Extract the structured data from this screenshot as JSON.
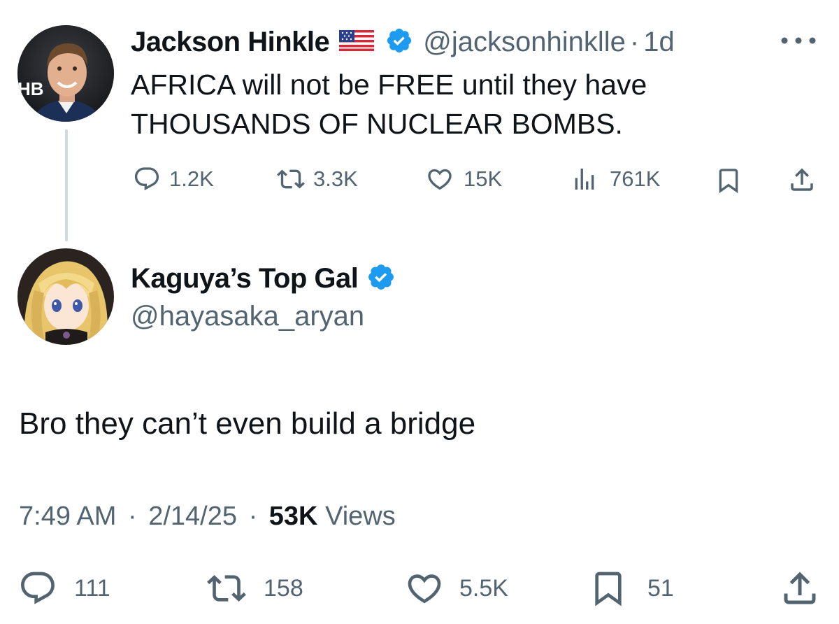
{
  "parent_tweet": {
    "author_name": "Jackson Hinkle",
    "flag_icon": "us-flag-icon",
    "verified_icon": "verified-badge-icon",
    "handle": "@jacksonhinklle",
    "separator": "·",
    "time_ago": "1d",
    "more_icon": "more-options-icon",
    "text_line1": "AFRICA will not be FREE until they have",
    "text_line2": "THOUSANDS OF NUCLEAR BOMBS.",
    "replies": "1.2K",
    "reposts": "3.3K",
    "likes": "15K",
    "views": "761K",
    "avatar_text": "HB"
  },
  "reply_tweet": {
    "author_name": "Kaguya’s Top Gal",
    "verified_icon": "verified-badge-icon",
    "handle": "@hayasaka_aryan",
    "text": "Bro they can’t even build a bridge",
    "time": "7:49 AM",
    "date": "2/14/25",
    "views_count": "53K",
    "views_label": "Views",
    "separator": "·",
    "replies": "111",
    "reposts": "158",
    "likes": "5.5K",
    "bookmarks": "51"
  },
  "colors": {
    "text_primary": "#0f1419",
    "text_secondary": "#536471",
    "verified_blue": "#1d9bf0",
    "thread_line": "#cfd9de"
  }
}
